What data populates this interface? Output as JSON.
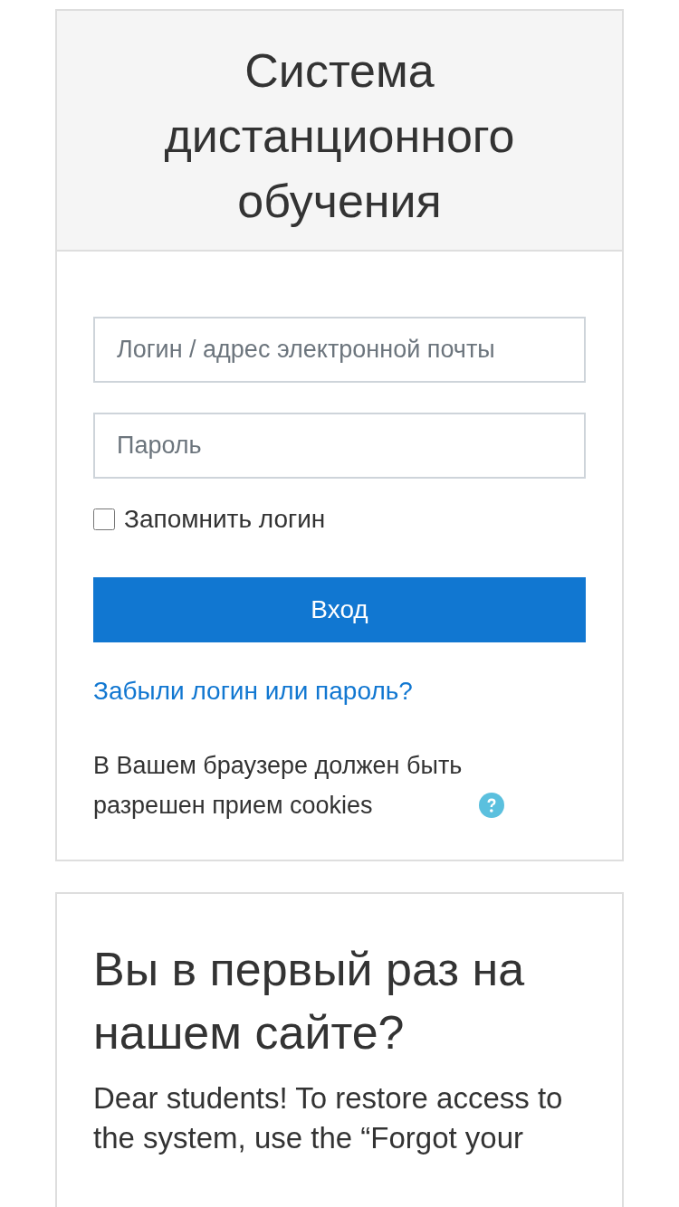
{
  "header": {
    "title": "Система дистанционного обучения"
  },
  "login": {
    "username": {
      "placeholder": "Логин / адрес электронной почты"
    },
    "password": {
      "placeholder": "Пароль"
    },
    "remember": {
      "label": "Запомнить логин",
      "checked": false
    },
    "submit": "Вход",
    "forgot_link": "Забыли логин или пароль?",
    "cookies_note": "В Вашем браузере должен быть разрешен прием cookies"
  },
  "first_time": {
    "title": "Вы в первый раз на нашем сайте?",
    "text": "Dear students! To restore access to the system, use the “Forgot your"
  }
}
